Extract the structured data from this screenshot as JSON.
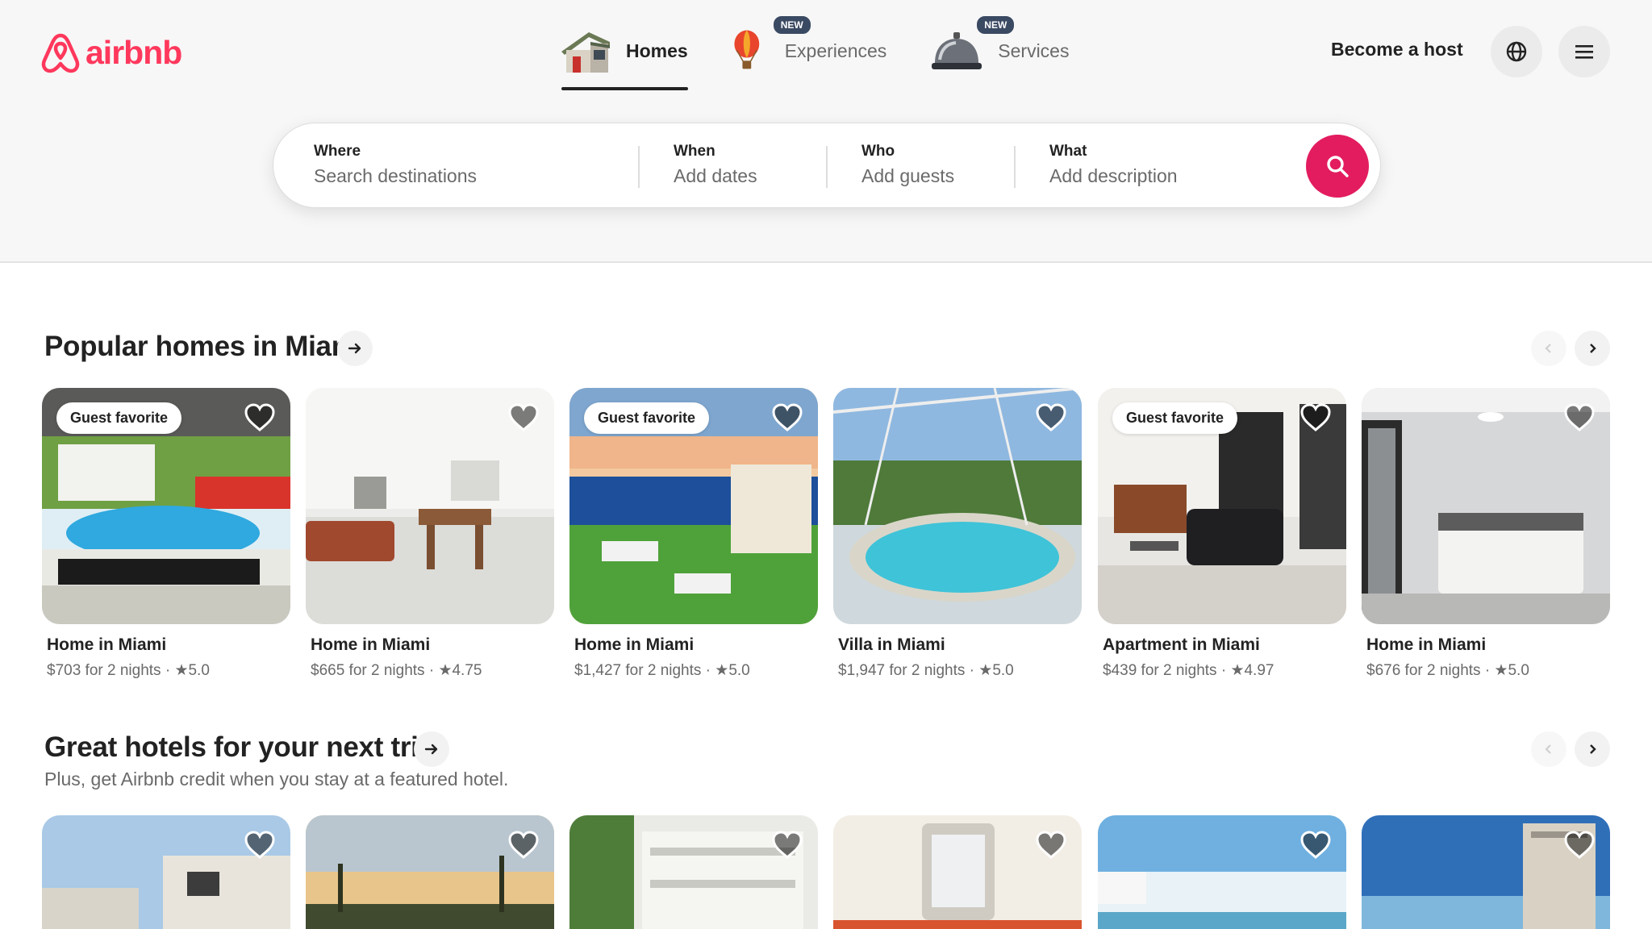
{
  "header": {
    "logo_text": "airbnb",
    "tabs": [
      {
        "label": "Homes",
        "active": true,
        "icon": "house-icon",
        "badge": ""
      },
      {
        "label": "Experiences",
        "active": false,
        "icon": "hot-air-balloon-icon",
        "badge": "NEW"
      },
      {
        "label": "Services",
        "active": false,
        "icon": "service-bell-icon",
        "badge": "NEW"
      }
    ],
    "become_host": "Become a host",
    "globe_icon": "globe-icon",
    "menu_icon": "hamburger-menu-icon"
  },
  "search": {
    "where_label": "Where",
    "where_placeholder": "Search destinations",
    "when_label": "When",
    "when_placeholder": "Add dates",
    "who_label": "Who",
    "who_placeholder": "Add guests",
    "what_label": "What",
    "what_placeholder": "Add description",
    "button_icon": "search-icon"
  },
  "colors": {
    "brand": "#ff385c",
    "search_button": "#e31c5f",
    "text": "#222222",
    "muted": "#6a6a6a"
  },
  "popular": {
    "title": "Popular homes in Miami",
    "listings": [
      {
        "badge": "Guest favorite",
        "title": "Home in Miami",
        "price": "$703 for 2 nights",
        "rating": "5.0"
      },
      {
        "badge": "",
        "title": "Home in Miami",
        "price": "$665 for 2 nights",
        "rating": "4.75"
      },
      {
        "badge": "Guest favorite",
        "title": "Home in Miami",
        "price": "$1,427 for 2 nights",
        "rating": "5.0"
      },
      {
        "badge": "",
        "title": "Villa in Miami",
        "price": "$1,947 for 2 nights",
        "rating": "5.0"
      },
      {
        "badge": "Guest favorite",
        "title": "Apartment in Miami",
        "price": "$439 for 2 nights",
        "rating": "4.97"
      },
      {
        "badge": "",
        "title": "Home in Miami",
        "price": "$676 for 2 nights",
        "rating": "5.0"
      }
    ]
  },
  "hotels": {
    "title": "Great hotels for your next trip",
    "subtitle": "Plus, get Airbnb credit when you stay at a featured hotel."
  }
}
